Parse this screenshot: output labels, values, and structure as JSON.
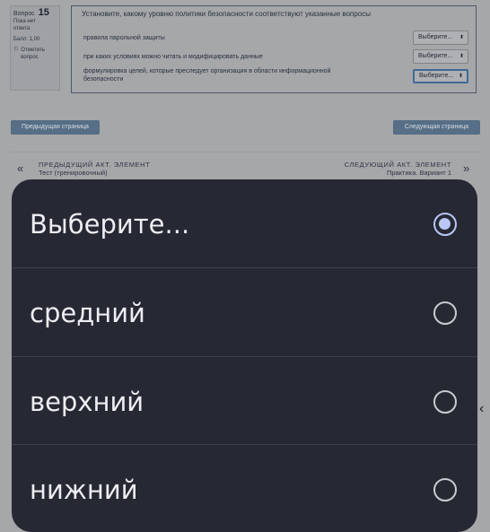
{
  "question_info": {
    "label": "Вопрос",
    "number": "15",
    "status_line1": "Пока нет",
    "status_line2": "ответа",
    "points": "Балл: 1,00",
    "flag_line1": "Отметить",
    "flag_line2": "вопрос"
  },
  "question": {
    "text": "Установите, какому уровню политики безопасности соответствуют указанные вопросы",
    "rows": [
      {
        "text": "правила парольной защиты",
        "select": "Выберите..."
      },
      {
        "text": "при каких условиях можно читать и модифицировать данные",
        "select": "Выберите..."
      },
      {
        "text_line1": "формулировка целей, которые преследует организация в области информационной",
        "text_line2": "безопасности",
        "select": "Выберите..."
      }
    ],
    "select_arrow": "⬍"
  },
  "nav": {
    "prev_page": "Предыдущая страница",
    "next_page": "Следующая страница"
  },
  "activity": {
    "prev_caption": "ПРЕДЫДУЩИЙ АКТ. ЭЛЕМЕНТ",
    "prev_title": "Тест (тренировочный)",
    "next_caption": "СЛЕДУЮЩИЙ АКТ. ЭЛЕМЕНТ",
    "next_title": "Практика. Вариант 1",
    "prev_chevron": "«",
    "next_chevron": "»"
  },
  "side_chevron": "‹",
  "picker": {
    "options": [
      {
        "label": "Выберите...",
        "selected": true
      },
      {
        "label": "средний",
        "selected": false
      },
      {
        "label": "верхний",
        "selected": false
      },
      {
        "label": "нижний",
        "selected": false
      }
    ]
  },
  "colors": {
    "background": "#a6a7a9",
    "picker_bg": "#262833",
    "radio_selected": "#b9c7f7",
    "button": "#566e86"
  }
}
